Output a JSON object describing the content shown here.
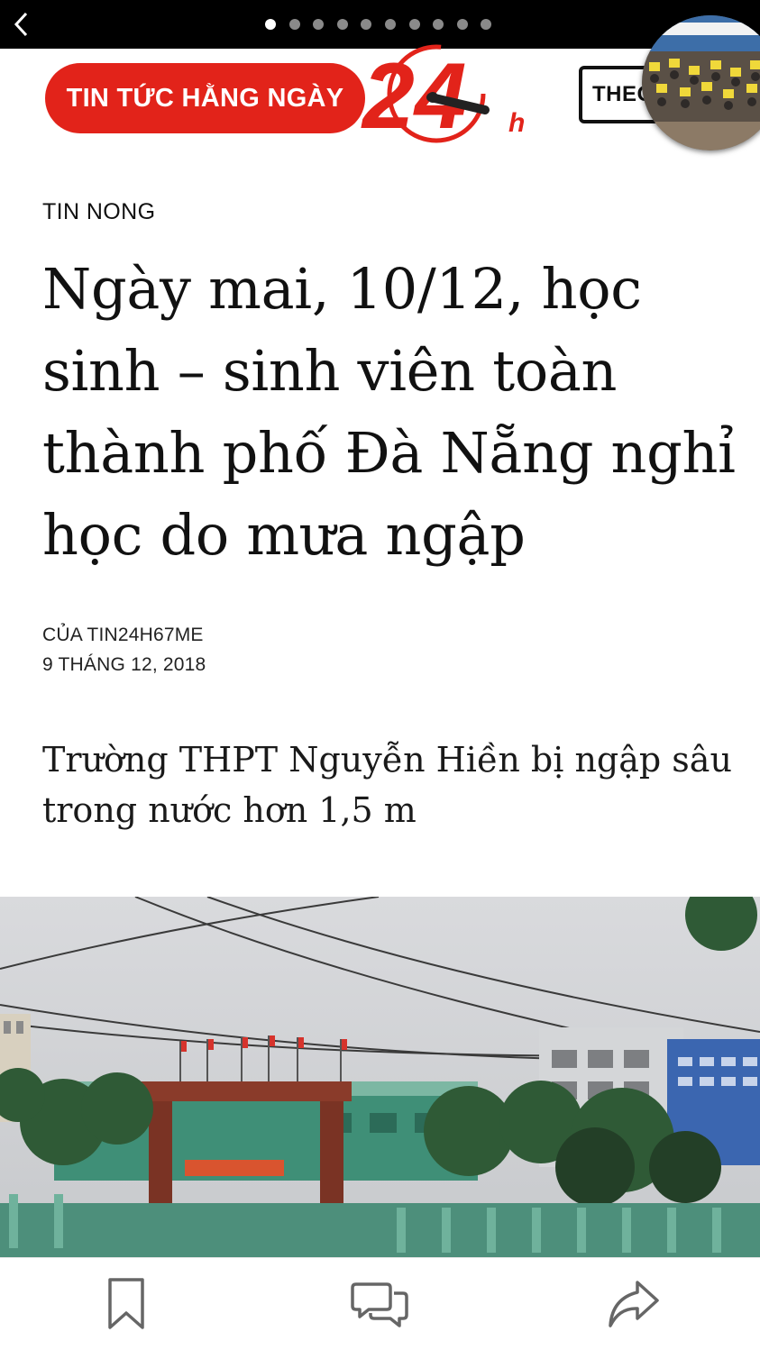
{
  "topbar": {
    "pages_total": 10,
    "current_page": 1
  },
  "masthead": {
    "logo_text": "TIN TỨC HẰNG NGÀY",
    "logo_number": "24",
    "logo_suffix": "h",
    "follow_label": "THEO"
  },
  "article": {
    "category": "TIN NONG",
    "headline": "Ngày mai, 10/12, học sinh – sinh viên toàn thành phố Đà Nẵng nghỉ học do mưa ngập",
    "author": "CỦA TIN24H67ME",
    "date": "9 THÁNG 12, 2018",
    "subtitle": "Trường THPT Nguyễn Hiền bị ngập sâu trong nước hơn 1,5 m"
  },
  "toolbar": {
    "icons": [
      "bookmark-icon",
      "comments-icon",
      "share-icon"
    ]
  },
  "colors": {
    "brand_red": "#e2231a",
    "topbar": "#000000"
  }
}
